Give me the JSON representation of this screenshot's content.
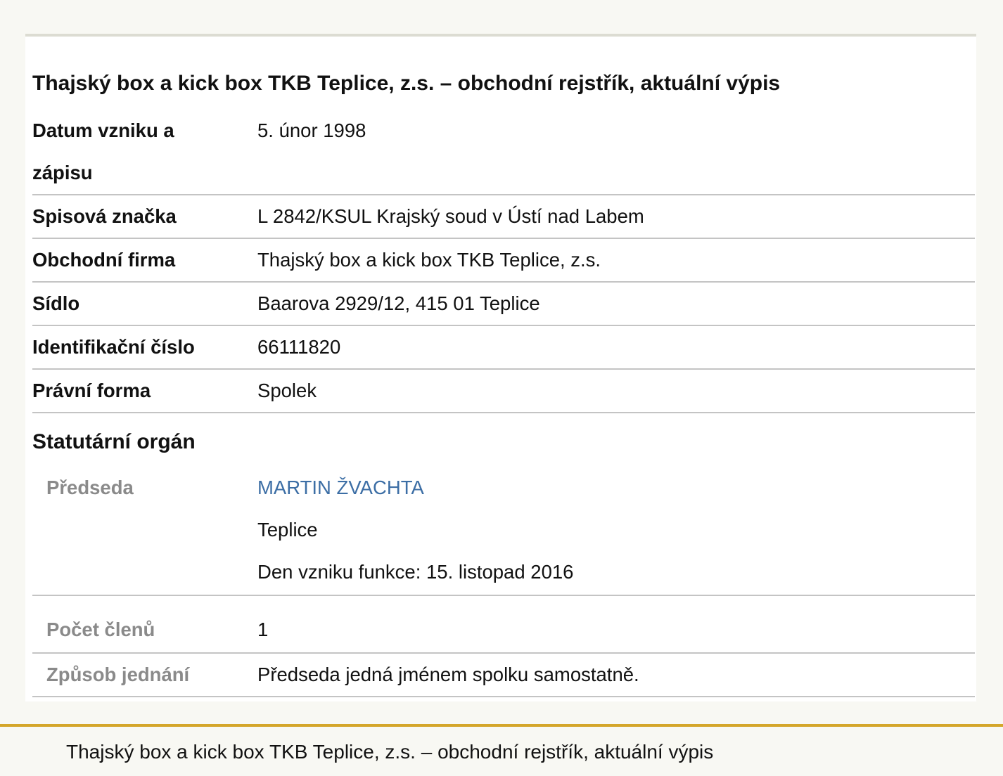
{
  "title": "Thajský box a kick box TKB Teplice, z.s. – obchodní rejstřík, aktuální výpis",
  "rows": [
    {
      "label_line1": "Datum vzniku a",
      "label_line2": "zápisu",
      "value": "5. únor 1998"
    },
    {
      "label": "Spisová značka",
      "value": "L 2842/KSUL Krajský soud v Ústí nad Labem"
    },
    {
      "label": "Obchodní firma",
      "value": "Thajský box a kick box TKB Teplice, z.s."
    },
    {
      "label": "Sídlo",
      "value": "Baarova 2929/12, 415 01 Teplice"
    },
    {
      "label": "Identifikační číslo",
      "value": "66111820"
    },
    {
      "label": "Právní forma",
      "value": "Spolek"
    }
  ],
  "statutory": {
    "heading": "Statutární orgán",
    "chair": {
      "label": "Předseda",
      "name": "MARTIN ŽVACHTA",
      "city": "Teplice",
      "since": "Den vzniku funkce: 15. listopad 2016"
    },
    "members": {
      "label": "Počet členů",
      "value": "1"
    },
    "conduct": {
      "label": "Způsob jednání",
      "value": "Předseda jedná jménem spolku samostatně."
    }
  },
  "footer": {
    "text": "Thajský box a kick box TKB Teplice, z.s. – obchodní rejstřík, aktuální výpis"
  },
  "colors": {
    "link": "#3c6ea5",
    "accent": "#d4a62a",
    "muted_label": "#8a8a8a"
  }
}
